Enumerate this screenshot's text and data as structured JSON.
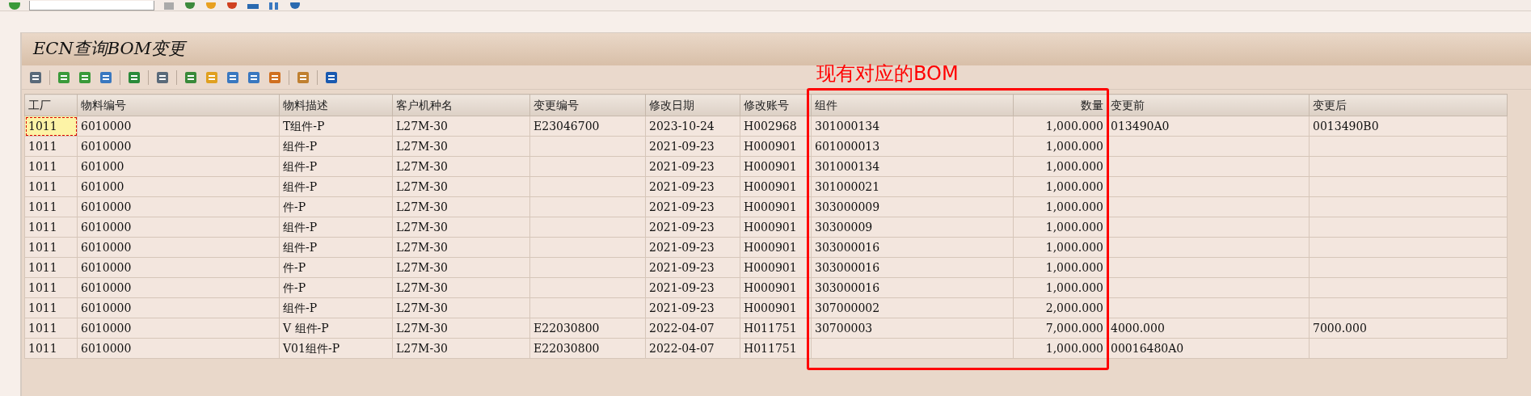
{
  "window": {
    "title": "ECN查询BOM变更"
  },
  "annotation": {
    "text": "现有对应的BOM",
    "color": "#ff0000"
  },
  "table": {
    "columns": [
      {
        "label": "工厂",
        "kind": "text"
      },
      {
        "label": "物料编号",
        "kind": "text"
      },
      {
        "label": "物料描述",
        "kind": "text"
      },
      {
        "label": "客户机种名",
        "kind": "text"
      },
      {
        "label": "变更编号",
        "kind": "text"
      },
      {
        "label": "修改日期",
        "kind": "text"
      },
      {
        "label": "修改账号",
        "kind": "text"
      },
      {
        "label": "组件",
        "kind": "text"
      },
      {
        "label": "数量",
        "kind": "number"
      },
      {
        "label": "变更前",
        "kind": "text"
      },
      {
        "label": "变更后",
        "kind": "text"
      }
    ],
    "rows": [
      {
        "selected": true,
        "cells": [
          "1011",
          "6010000",
          "T组件-P",
          "L27M-30",
          "E23046700",
          "2023-10-24",
          "H002968",
          "301000134",
          "1,000.000",
          "013490A0",
          "0013490B0"
        ]
      },
      {
        "selected": false,
        "cells": [
          "1011",
          "6010000",
          "组件-P",
          "L27M-30",
          "",
          "2021-09-23",
          "H000901",
          "601000013",
          "1,000.000",
          "",
          ""
        ]
      },
      {
        "selected": false,
        "cells": [
          "1011",
          "601000",
          "组件-P",
          "L27M-30",
          "",
          "2021-09-23",
          "H000901",
          "301000134",
          "1,000.000",
          "",
          ""
        ]
      },
      {
        "selected": false,
        "cells": [
          "1011",
          "601000",
          "组件-P",
          "L27M-30",
          "",
          "2021-09-23",
          "H000901",
          "301000021",
          "1,000.000",
          "",
          ""
        ]
      },
      {
        "selected": false,
        "cells": [
          "1011",
          "6010000",
          "件-P",
          "L27M-30",
          "",
          "2021-09-23",
          "H000901",
          "303000009",
          "1,000.000",
          "",
          ""
        ]
      },
      {
        "selected": false,
        "cells": [
          "1011",
          "6010000",
          "组件-P",
          "L27M-30",
          "",
          "2021-09-23",
          "H000901",
          "30300009",
          "1,000.000",
          "",
          ""
        ]
      },
      {
        "selected": false,
        "cells": [
          "1011",
          "6010000",
          "组件-P",
          "L27M-30",
          "",
          "2021-09-23",
          "H000901",
          "303000016",
          "1,000.000",
          "",
          ""
        ]
      },
      {
        "selected": false,
        "cells": [
          "1011",
          "6010000",
          "件-P",
          "L27M-30",
          "",
          "2021-09-23",
          "H000901",
          "303000016",
          "1,000.000",
          "",
          ""
        ]
      },
      {
        "selected": false,
        "cells": [
          "1011",
          "6010000",
          "件-P",
          "L27M-30",
          "",
          "2021-09-23",
          "H000901",
          "303000016",
          "1,000.000",
          "",
          ""
        ]
      },
      {
        "selected": false,
        "cells": [
          "1011",
          "6010000",
          "组件-P",
          "L27M-30",
          "",
          "2021-09-23",
          "H000901",
          "307000002",
          "2,000.000",
          "",
          ""
        ]
      },
      {
        "selected": false,
        "cells": [
          "1011",
          "6010000",
          "V 组件-P",
          "L27M-30",
          "E22030800",
          "2022-04-07",
          "H011751",
          "30700003",
          "7,000.000",
          "4000.000",
          "7000.000"
        ]
      },
      {
        "selected": false,
        "cells": [
          "1011",
          "6010000",
          "V01组件-P",
          "L27M-30",
          "E22030800",
          "2022-04-07",
          "H011751",
          "",
          "1,000.000",
          "00016480A0",
          ""
        ]
      }
    ]
  }
}
